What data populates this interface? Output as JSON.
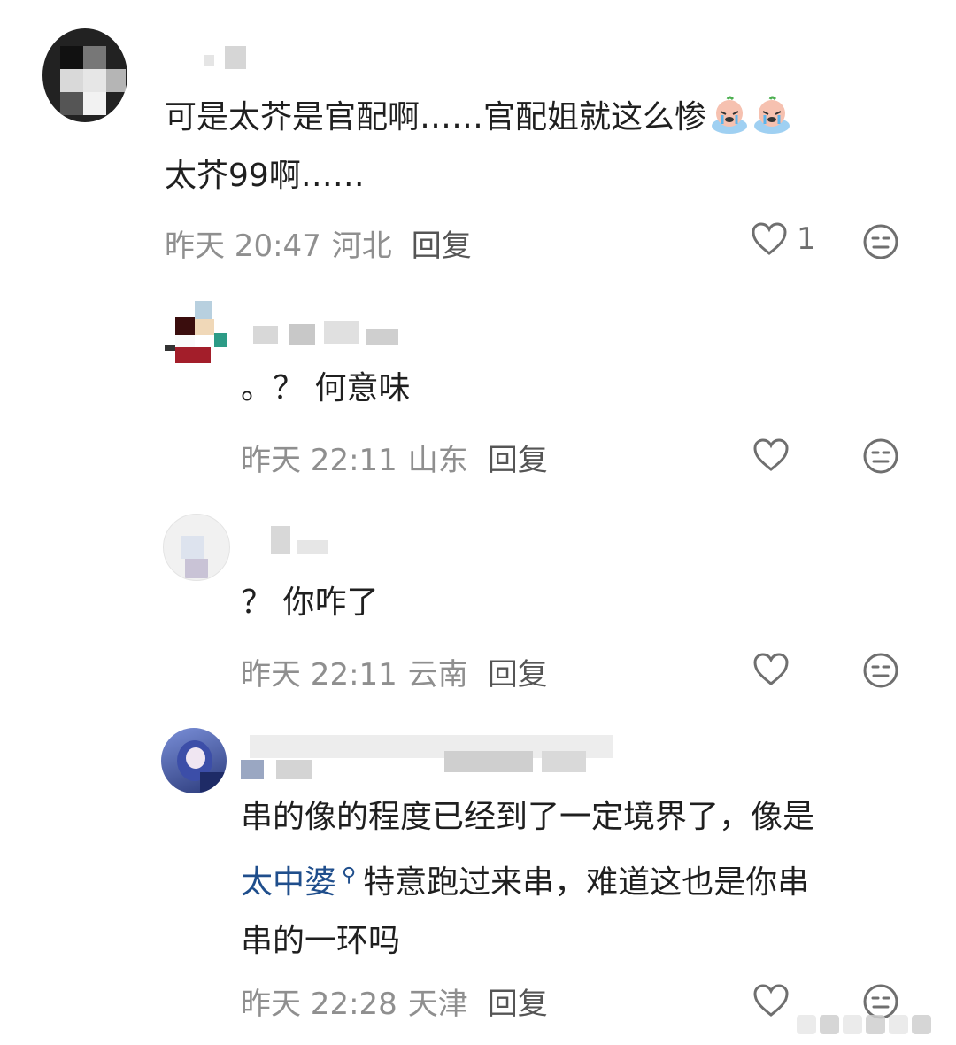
{
  "comments": [
    {
      "text_lines": [
        "可是太芥是官配啊……官配姐就这么惨",
        "太芥99啊……"
      ],
      "emojis": [
        "crying-face-emoji",
        "crying-face-emoji"
      ],
      "time": "昨天 20:47",
      "location": "河北",
      "reply_label": "回复",
      "like_count": "1"
    },
    {
      "text_lines": [
        "。？ 何意味"
      ],
      "time": "昨天 22:11",
      "location": "山东",
      "reply_label": "回复"
    },
    {
      "text_lines": [
        "？ 你咋了"
      ],
      "time": "昨天 22:11",
      "location": "云南",
      "reply_label": "回复"
    },
    {
      "text_line1": "串的像的程度已经到了一定境界了，像是",
      "link_text": "太中婆",
      "text_line2_rest": "特意跑过来串，难道这也是你串",
      "text_line3": "串的一环吗",
      "time": "昨天 22:28",
      "location": "天津",
      "reply_label": "回复"
    }
  ],
  "colors": {
    "text": "#1f1f1f",
    "meta": "#8f8f8f",
    "link": "#1f4e8c",
    "icon": "#6f6f6f"
  }
}
